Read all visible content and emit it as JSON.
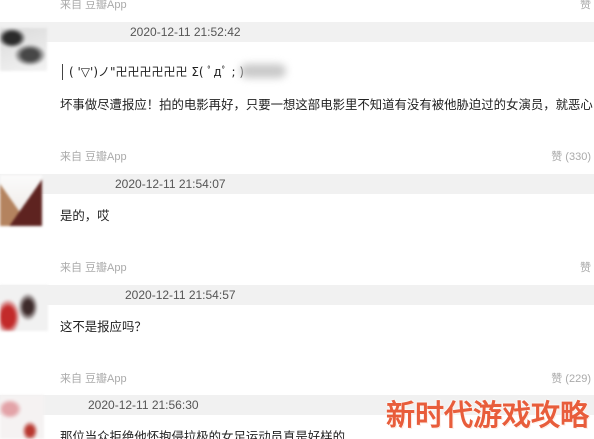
{
  "previous_footer": {
    "source": "来自 豆瓣App",
    "like": "赞"
  },
  "comments": [
    {
      "datetime": "2020-12-11 21:52:42",
      "quote": "( '▽')ノ\"卍卍卍卍卍卍 Σ( ﾟдﾟ ; )",
      "text": "坏事做尽遭报应！拍的电影再好，只要一想这部电影里不知道有没有被他胁迫过的女演员，就恶心",
      "source": "来自 豆瓣App",
      "like": "赞 (330)"
    },
    {
      "datetime": "2020-12-11 21:54:07",
      "text": "是的，哎",
      "source": "来自 豆瓣App",
      "like": "赞"
    },
    {
      "datetime": "2020-12-11 21:54:57",
      "text": "这不是报应吗？",
      "source": "来自 豆瓣App",
      "like": "赞 (229)"
    },
    {
      "datetime": "2020-12-11 21:56:30",
      "text": "那位当众拒绝他怀抱侵拉极的女足运动员真是好样的"
    }
  ],
  "watermark": {
    "text": "新时代游戏攻略"
  },
  "colors": {
    "bar": "#f1f1f1",
    "text": "#222222",
    "meta": "#aaaaaa",
    "date": "#555555",
    "watermark": "#e85d3b"
  }
}
